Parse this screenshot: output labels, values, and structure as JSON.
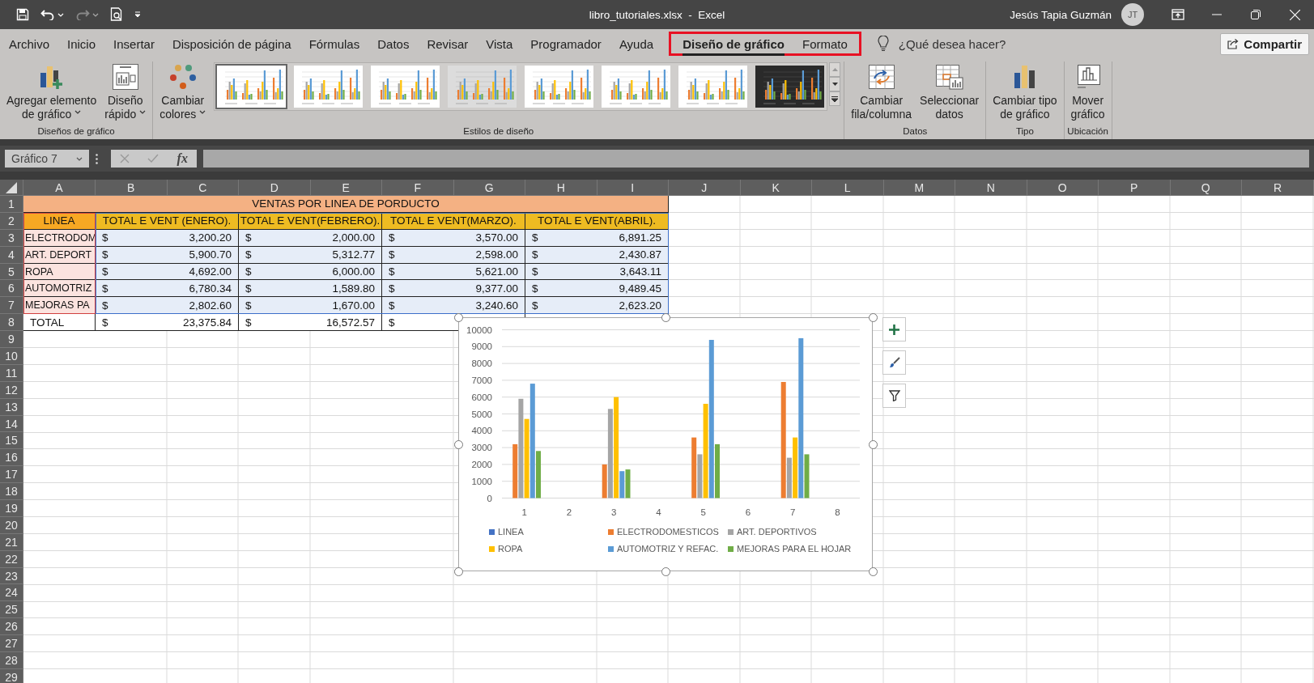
{
  "window": {
    "title": "libro_tutoriales.xlsx  -  Excel",
    "user": "Jesús Tapia Guzmán",
    "avatar": "JT"
  },
  "menu_tabs": [
    {
      "label": "Archivo",
      "selected": false
    },
    {
      "label": "Inicio",
      "selected": false
    },
    {
      "label": "Insertar",
      "selected": false
    },
    {
      "label": "Disposición de página",
      "selected": false
    },
    {
      "label": "Fórmulas",
      "selected": false
    },
    {
      "label": "Datos",
      "selected": false
    },
    {
      "label": "Revisar",
      "selected": false
    },
    {
      "label": "Vista",
      "selected": false
    },
    {
      "label": "Programador",
      "selected": false
    },
    {
      "label": "Ayuda",
      "selected": false
    },
    {
      "label": "Diseño de gráfico",
      "selected": true
    },
    {
      "label": "Formato",
      "selected": false
    }
  ],
  "tell_me": {
    "placeholder": "¿Qué desea hacer?"
  },
  "share_button": "Compartir",
  "ribbon": {
    "groups": [
      {
        "label": "Diseños de gráfico",
        "buttons": [
          {
            "lines": [
              "Agregar elemento",
              "de gráfico"
            ],
            "dropdown": true
          },
          {
            "lines": [
              "Diseño",
              "rápido"
            ],
            "dropdown": true
          }
        ]
      },
      {
        "label": "Estilos de diseño",
        "buttons": [
          {
            "lines": [
              "Cambiar",
              "colores"
            ],
            "dropdown": true
          }
        ],
        "styles": [
          {
            "kind": "light",
            "selected": true
          },
          {
            "kind": "light",
            "selected": false
          },
          {
            "kind": "light",
            "selected": false
          },
          {
            "kind": "shaded",
            "selected": false
          },
          {
            "kind": "light",
            "selected": false
          },
          {
            "kind": "light",
            "selected": false
          },
          {
            "kind": "light",
            "selected": false
          },
          {
            "kind": "dark",
            "selected": false
          }
        ]
      },
      {
        "label": "Datos",
        "buttons": [
          {
            "lines": [
              "Cambiar",
              "fila/columna"
            ],
            "dropdown": false
          },
          {
            "lines": [
              "Seleccionar",
              "datos"
            ],
            "dropdown": false
          }
        ]
      },
      {
        "label": "Tipo",
        "buttons": [
          {
            "lines": [
              "Cambiar tipo",
              "de gráfico"
            ],
            "dropdown": false
          }
        ]
      },
      {
        "label": "Ubicación",
        "buttons": [
          {
            "lines": [
              "Mover",
              "gráfico"
            ],
            "dropdown": false
          }
        ]
      }
    ]
  },
  "formula_bar": {
    "name_box": "Gráfico 7",
    "function_label": "fx"
  },
  "sheet": {
    "columns": [
      "A",
      "B",
      "C",
      "D",
      "E",
      "F",
      "G",
      "H",
      "I",
      "J",
      "K",
      "L",
      "M",
      "N",
      "O",
      "P",
      "Q",
      "R"
    ],
    "row_numbers": [
      "1",
      "2",
      "3",
      "4",
      "5",
      "6",
      "7",
      "8",
      "9",
      "10",
      "11",
      "12",
      "13",
      "14",
      "15",
      "16",
      "17",
      "18",
      "19",
      "20",
      "21",
      "22",
      "23",
      "24",
      "25",
      "26",
      "27",
      "28",
      "29"
    ],
    "table": {
      "title": "VENTAS POR LINEA DE PORDUCTO",
      "headers": [
        "LINEA",
        "TOTAL E VENT (ENERO).",
        "TOTAL E VENT(FEBRERO).",
        "TOTAL E VENT(MARZO).",
        "TOTAL E VENT(ABRIL)."
      ],
      "rows": [
        {
          "label": "ELECTRODOM",
          "values": [
            {
              "currency": "$",
              "amount": "3,200.20"
            },
            {
              "currency": "$",
              "amount": "2,000.00"
            },
            {
              "currency": "$",
              "amount": "3,570.00"
            },
            {
              "currency": "$",
              "amount": "6,891.25"
            }
          ]
        },
        {
          "label": "ART. DEPORT",
          "values": [
            {
              "currency": "$",
              "amount": "5,900.70"
            },
            {
              "currency": "$",
              "amount": "5,312.77"
            },
            {
              "currency": "$",
              "amount": "2,598.00"
            },
            {
              "currency": "$",
              "amount": "2,430.87"
            }
          ]
        },
        {
          "label": "ROPA",
          "values": [
            {
              "currency": "$",
              "amount": "4,692.00"
            },
            {
              "currency": "$",
              "amount": "6,000.00"
            },
            {
              "currency": "$",
              "amount": "5,621.00"
            },
            {
              "currency": "$",
              "amount": "3,643.11"
            }
          ]
        },
        {
          "label": "AUTOMOTRIZ",
          "values": [
            {
              "currency": "$",
              "amount": "6,780.34"
            },
            {
              "currency": "$",
              "amount": "1,589.80"
            },
            {
              "currency": "$",
              "amount": "9,377.00"
            },
            {
              "currency": "$",
              "amount": "9,489.45"
            }
          ]
        },
        {
          "label": "MEJORAS PA",
          "values": [
            {
              "currency": "$",
              "amount": "2,802.60"
            },
            {
              "currency": "$",
              "amount": "1,670.00"
            },
            {
              "currency": "$",
              "amount": "3,240.60"
            },
            {
              "currency": "$",
              "amount": "2,623.20"
            }
          ]
        }
      ],
      "total": {
        "label": "TOTAL",
        "values": [
          {
            "currency": "$",
            "amount": "23,375.84"
          },
          {
            "currency": "$",
            "amount": "16,572.57"
          },
          {
            "currency": "$"
          }
        ]
      }
    },
    "chart": {
      "chart_data": {
        "type": "bar",
        "grid": true,
        "legend": true,
        "categories": [
          "1",
          "2",
          "3",
          "4",
          "5",
          "6",
          "7",
          "8"
        ],
        "ylim": [
          0,
          10000
        ],
        "yticks": [
          0,
          1000,
          2000,
          3000,
          4000,
          5000,
          6000,
          7000,
          8000,
          9000,
          10000
        ],
        "series": [
          {
            "name": "LINEA",
            "color": "#4472c4",
            "values": [
              null,
              null,
              null,
              null,
              null,
              null,
              null,
              null
            ]
          },
          {
            "name": "ELECTRODOMESTICOS",
            "color": "#ed7d31",
            "values": [
              3200,
              null,
              2000,
              null,
              3600,
              null,
              6900,
              null
            ]
          },
          {
            "name": "ART. DEPORTIVOS",
            "color": "#a5a5a5",
            "values": [
              5900,
              null,
              5300,
              null,
              2600,
              null,
              2400,
              null
            ]
          },
          {
            "name": "ROPA",
            "color": "#ffc000",
            "values": [
              4700,
              null,
              6000,
              null,
              5600,
              null,
              3600,
              null
            ]
          },
          {
            "name": "AUTOMOTRIZ Y REFAC.",
            "color": "#5b9bd5",
            "values": [
              6800,
              null,
              1600,
              null,
              9400,
              null,
              9500,
              null
            ]
          },
          {
            "name": "MEJORAS PARA EL HOJAR",
            "color": "#70ad47",
            "values": [
              2800,
              null,
              1700,
              null,
              3200,
              null,
              2600,
              null
            ]
          }
        ]
      }
    }
  }
}
